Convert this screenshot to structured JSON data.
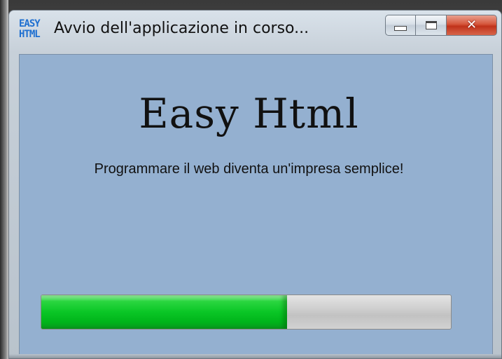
{
  "window": {
    "title": "Avvio dell'applicazione in corso...",
    "app_icon_text_line1": "EASY",
    "app_icon_text_line2": "HTML",
    "caption_buttons": {
      "minimize": "minimize",
      "maximize": "maximize",
      "close": "close"
    },
    "colors": {
      "client_background": "#94b0d0",
      "close_button": "#c0321a",
      "progress_fill": "#0ac626",
      "progress_track": "#cfcfcf"
    }
  },
  "splash": {
    "heading": "Easy Html",
    "subtitle": "Programmare il web diventa un'impresa semplice!"
  },
  "progress": {
    "fraction": 0.6
  },
  "icons": [
    "app-logo-icon",
    "minimize-icon",
    "maximize-icon",
    "close-icon"
  ]
}
